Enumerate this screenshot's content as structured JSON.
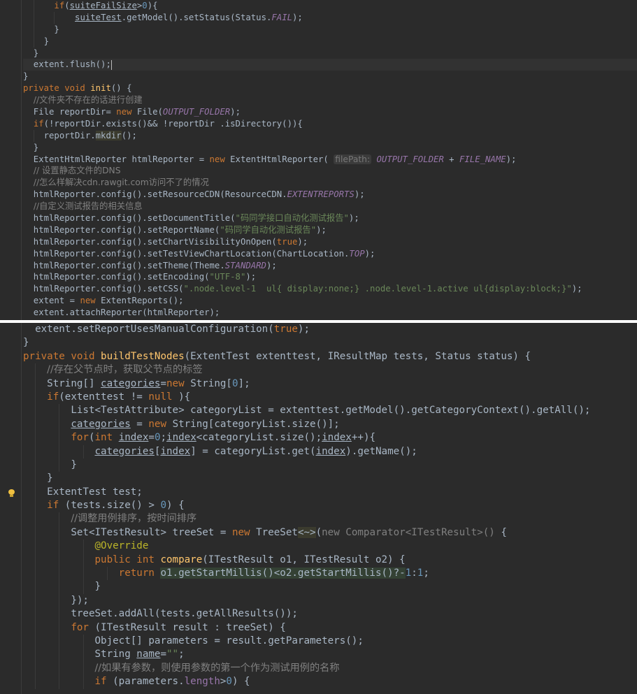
{
  "pane1": {
    "lines": [
      [
        [
          "      ",
          ""
        ],
        [
          "if",
          "k"
        ],
        [
          "(",
          ""
        ],
        [
          "suiteFailSize",
          "ul"
        ],
        [
          ">",
          ""
        ],
        [
          "0",
          "n"
        ],
        [
          "){",
          ""
        ]
      ],
      [
        [
          "          ",
          ""
        ],
        [
          "suiteTest",
          "ul"
        ],
        [
          ".getModel().setStatus(Status.",
          ""
        ],
        [
          "FAIL",
          "cf"
        ],
        [
          ");",
          ""
        ]
      ],
      [
        [
          "      }",
          ""
        ]
      ],
      [
        [
          "    }",
          ""
        ]
      ],
      [
        [
          "  }",
          ""
        ]
      ],
      [
        [
          "  extent.flush();",
          ""
        ],
        [
          "",
          "caret"
        ]
      ],
      [
        [
          "}",
          ""
        ]
      ],
      [
        [
          "private void ",
          "k"
        ],
        [
          "init",
          "f"
        ],
        [
          "() {",
          ""
        ]
      ],
      [
        [
          "  ",
          ""
        ],
        [
          "//文件夹不存在的话进行创建",
          "cz"
        ]
      ],
      [
        [
          "  File reportDir= ",
          ""
        ],
        [
          "new ",
          "k"
        ],
        [
          "File(",
          ""
        ],
        [
          "OUTPUT_FOLDER",
          "cf"
        ],
        [
          ");",
          ""
        ]
      ],
      [
        [
          "  ",
          ""
        ],
        [
          "if",
          "k"
        ],
        [
          "(!reportDir.exists()&& !reportDir .isDirectory()){",
          ""
        ]
      ],
      [
        [
          "    reportDir.",
          ""
        ],
        [
          "mkdir",
          "hl2"
        ],
        [
          "();",
          ""
        ]
      ],
      [
        [
          "  }",
          ""
        ]
      ],
      [
        [
          "  ExtentHtmlReporter htmlReporter = ",
          ""
        ],
        [
          "new ",
          "k"
        ],
        [
          "ExtentHtmlReporter( ",
          ""
        ],
        [
          "filePath:",
          "hint"
        ],
        [
          " ",
          ""
        ],
        [
          "OUTPUT_FOLDER",
          "cf"
        ],
        [
          " + ",
          ""
        ],
        [
          "FILE_NAME",
          "cf"
        ],
        [
          ");",
          ""
        ]
      ],
      [
        [
          "  ",
          ""
        ],
        [
          "// 设置静态文件的DNS",
          "cz"
        ]
      ],
      [
        [
          "  ",
          ""
        ],
        [
          "//怎么样解决cdn.rawgit.com访问不了的情况",
          "cz"
        ]
      ],
      [
        [
          "  htmlReporter.config().setResourceCDN(ResourceCDN.",
          ""
        ],
        [
          "EXTENTREPORTS",
          "cf"
        ],
        [
          ");",
          ""
        ]
      ],
      [
        [
          "  ",
          ""
        ],
        [
          "//自定义测试报告的相关信息",
          "cz"
        ]
      ],
      [
        [
          "  htmlReporter.config().setDocumentTitle(",
          ""
        ],
        [
          "\"码同学接口自动化测试报告\"",
          "s"
        ],
        [
          ");",
          ""
        ]
      ],
      [
        [
          "  htmlReporter.config().setReportName(",
          ""
        ],
        [
          "\"码同学自动化测试报告\"",
          "s"
        ],
        [
          ");",
          ""
        ]
      ],
      [
        [
          "  htmlReporter.config().setChartVisibilityOnOpen(",
          ""
        ],
        [
          "true",
          "k"
        ],
        [
          ");",
          ""
        ]
      ],
      [
        [
          "  htmlReporter.config().setTestViewChartLocation(ChartLocation.",
          ""
        ],
        [
          "TOP",
          "cf"
        ],
        [
          ");",
          ""
        ]
      ],
      [
        [
          "  htmlReporter.config().setTheme(Theme.",
          ""
        ],
        [
          "STANDARD",
          "cf"
        ],
        [
          ");",
          ""
        ]
      ],
      [
        [
          "  htmlReporter.config().setEncoding(",
          ""
        ],
        [
          "\"UTF-8\"",
          "s"
        ],
        [
          ");",
          ""
        ]
      ],
      [
        [
          "  htmlReporter.config().setCSS(",
          ""
        ],
        [
          "\".node.level-1  ul{ display:none;} .node.level-1.active ul{display:block;}\"",
          "s"
        ],
        [
          ");",
          ""
        ]
      ],
      [
        [
          "  extent = ",
          ""
        ],
        [
          "new ",
          "k"
        ],
        [
          "ExtentReports();",
          ""
        ]
      ],
      [
        [
          "  extent.attachReporter(htmlReporter);",
          ""
        ]
      ]
    ]
  },
  "pane2": {
    "lines": [
      [
        [
          "  extent.setReportUsesManualConfiguration(",
          ""
        ],
        [
          "true",
          "k"
        ],
        [
          ");",
          ""
        ]
      ],
      [
        [
          "}",
          ""
        ]
      ],
      [
        [
          "private void ",
          "k"
        ],
        [
          "buildTestNodes",
          "f"
        ],
        [
          "(ExtentTest extenttest, IResultMap tests, Status status) {",
          ""
        ]
      ],
      [
        [
          "    ",
          ""
        ],
        [
          "//存在父节点时，获取父节点的标签",
          "cz"
        ]
      ],
      [
        [
          "    String[] ",
          ""
        ],
        [
          "categories",
          "ul"
        ],
        [
          "=",
          ""
        ],
        [
          "new ",
          "k"
        ],
        [
          "String[",
          ""
        ],
        [
          "0",
          "n"
        ],
        [
          "];",
          ""
        ]
      ],
      [
        [
          "    ",
          ""
        ],
        [
          "if",
          "k"
        ],
        [
          "(extenttest != ",
          ""
        ],
        [
          "null ",
          "k"
        ],
        [
          "){",
          ""
        ]
      ],
      [
        [
          "        List<TestAttribute> categoryList = extenttest.getModel().getCategoryContext().getAll();",
          ""
        ]
      ],
      [
        [
          "        ",
          ""
        ],
        [
          "categories",
          "ul"
        ],
        [
          " = ",
          ""
        ],
        [
          "new ",
          "k"
        ],
        [
          "String[categoryList.size()];",
          ""
        ]
      ],
      [
        [
          "        ",
          ""
        ],
        [
          "for",
          "k"
        ],
        [
          "(",
          ""
        ],
        [
          "int ",
          "k"
        ],
        [
          "index",
          "ul"
        ],
        [
          "=",
          ""
        ],
        [
          "0",
          "n"
        ],
        [
          ";",
          ""
        ],
        [
          "index",
          "ul"
        ],
        [
          "<categoryList.size();",
          ""
        ],
        [
          "index",
          "ul"
        ],
        [
          "++){",
          ""
        ]
      ],
      [
        [
          "            ",
          ""
        ],
        [
          "categories",
          "ul"
        ],
        [
          "[",
          ""
        ],
        [
          "index",
          "ul"
        ],
        [
          "] = categoryList.get(",
          ""
        ],
        [
          "index",
          "ul"
        ],
        [
          ").getName();",
          ""
        ]
      ],
      [
        [
          "        }",
          ""
        ]
      ],
      [
        [
          "    }",
          ""
        ]
      ],
      [
        [
          "    ExtentTest test;",
          ""
        ]
      ],
      [
        [
          "    ",
          ""
        ],
        [
          "if ",
          "k"
        ],
        [
          "(tests.size() > ",
          ""
        ],
        [
          "0",
          "n"
        ],
        [
          ") {",
          ""
        ]
      ],
      [
        [
          "        ",
          ""
        ],
        [
          "//调整用例排序，按时间排序",
          "cz"
        ]
      ],
      [
        [
          "        Set<ITestResult> treeSet = ",
          ""
        ],
        [
          "new ",
          "k"
        ],
        [
          "TreeSet",
          ""
        ],
        [
          "<~>",
          "hl2"
        ],
        [
          "(",
          ""
        ],
        [
          "new Comparator<ITestResult>() ",
          "c"
        ],
        [
          "{",
          ""
        ]
      ],
      [
        [
          "            ",
          ""
        ],
        [
          "@Override",
          "an"
        ]
      ],
      [
        [
          "            ",
          ""
        ],
        [
          "public int ",
          "k"
        ],
        [
          "compare",
          "f"
        ],
        [
          "(ITestResult o1, ITestResult o2) {",
          ""
        ]
      ],
      [
        [
          "                ",
          ""
        ],
        [
          "return ",
          "k"
        ],
        [
          "o1.getStartMillis()<o2.getStartMillis()?-",
          ""
        ],
        [
          "1",
          "n"
        ],
        [
          ":",
          ""
        ],
        [
          "1",
          "n"
        ],
        [
          ";",
          ""
        ]
      ],
      [
        [
          "            }",
          ""
        ]
      ],
      [
        [
          "        });",
          ""
        ]
      ],
      [
        [
          "        treeSet.addAll(tests.getAllResults());",
          ""
        ]
      ],
      [
        [
          "        ",
          ""
        ],
        [
          "for ",
          "k"
        ],
        [
          "(ITestResult result : treeSet) {",
          ""
        ]
      ],
      [
        [
          "            Object[] parameters = result.getParameters();",
          ""
        ]
      ],
      [
        [
          "            String ",
          ""
        ],
        [
          "name",
          "ul"
        ],
        [
          "=",
          ""
        ],
        [
          "\"\"",
          "s"
        ],
        [
          ";",
          ""
        ]
      ],
      [
        [
          "            ",
          ""
        ],
        [
          "//如果有参数，则使用参数的第一个作为测试用例的名称",
          "cz"
        ]
      ],
      [
        [
          "            ",
          ""
        ],
        [
          "if ",
          "k"
        ],
        [
          "(parameters.",
          ""
        ],
        [
          "length",
          "pf"
        ],
        [
          ">",
          ""
        ],
        [
          "0",
          "n"
        ],
        [
          ") {",
          ""
        ]
      ]
    ]
  },
  "icons": {
    "intention": "lightbulb-icon"
  }
}
